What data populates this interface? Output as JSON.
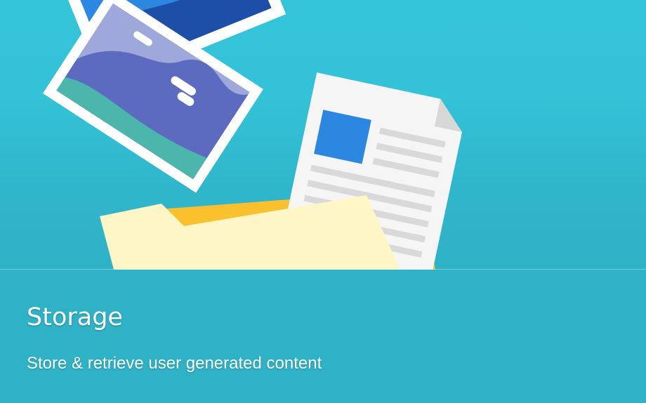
{
  "card": {
    "title": "Storage",
    "description": "Store & retrieve user generated content"
  },
  "illustration": {
    "icons": [
      "photo-icon",
      "photo-icon",
      "document-icon",
      "folder-icon"
    ]
  },
  "colors": {
    "background": "#2fb1c6",
    "hero_top": "#34c4d9",
    "folder_back": "#fbc02d",
    "folder_front": "#fff6c7",
    "document_accent": "#2b87e0"
  }
}
